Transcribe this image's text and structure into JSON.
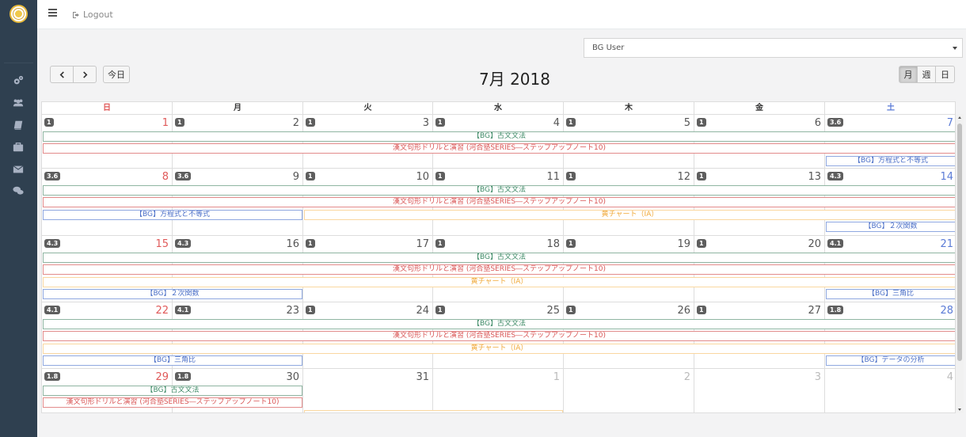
{
  "header": {
    "logout_label": "Logout"
  },
  "select": {
    "value": "BG User"
  },
  "toolbar": {
    "today_label": "今日",
    "title": "7月 2018",
    "views": [
      "月",
      "週",
      "日"
    ]
  },
  "dow": [
    "日",
    "月",
    "火",
    "水",
    "木",
    "金",
    "土"
  ],
  "colors": {
    "sidebar": "#2f4050",
    "sunday": "#e05a5a",
    "saturday": "#5b7bd6",
    "green_event": "#3d8a66",
    "red_event": "#d95555",
    "blue_event": "#4b6fc7",
    "orange_event": "#f0a93a"
  },
  "icons": [
    "gears-icon",
    "users-icon",
    "book-icon",
    "briefcase-icon",
    "envelope-icon",
    "chat-icon"
  ],
  "weeks": [
    {
      "days": [
        {
          "num": "1",
          "badge": "1",
          "type": "sun"
        },
        {
          "num": "2",
          "badge": "1"
        },
        {
          "num": "3",
          "badge": "1"
        },
        {
          "num": "4",
          "badge": "1"
        },
        {
          "num": "5",
          "badge": "1"
        },
        {
          "num": "6",
          "badge": "1"
        },
        {
          "num": "7",
          "badge": "3.6",
          "type": "sat"
        }
      ],
      "events": [
        {
          "title": "【BG】古文文法",
          "color": "green",
          "start": 0,
          "end": 6,
          "row": 0
        },
        {
          "title": "漢文句形ドリルと演習 (河合塾SERIES―ステップアップノート10)",
          "color": "red",
          "start": 0,
          "end": 6,
          "row": 1
        },
        {
          "title": "【BG】方程式と不等式",
          "color": "blue",
          "start": 6,
          "end": 6,
          "row": 2
        }
      ]
    },
    {
      "days": [
        {
          "num": "8",
          "badge": "3.6",
          "type": "sun"
        },
        {
          "num": "9",
          "badge": "3.6"
        },
        {
          "num": "10",
          "badge": "1"
        },
        {
          "num": "11",
          "badge": "1"
        },
        {
          "num": "12",
          "badge": "1"
        },
        {
          "num": "13",
          "badge": "1"
        },
        {
          "num": "14",
          "badge": "4.3",
          "type": "sat"
        }
      ],
      "events": [
        {
          "title": "【BG】古文文法",
          "color": "green",
          "start": 0,
          "end": 6,
          "row": 0
        },
        {
          "title": "漢文句形ドリルと演習 (河合塾SERIES―ステップアップノート10)",
          "color": "red",
          "start": 0,
          "end": 6,
          "row": 1
        },
        {
          "title": "【BG】方程式と不等式",
          "color": "blue",
          "start": 0,
          "end": 1,
          "row": 2
        },
        {
          "title": "黄チャート（ⅠA）",
          "color": "orange",
          "start": 2,
          "end": 6,
          "row": 2
        },
        {
          "title": "【BG】２次関数",
          "color": "blue",
          "start": 6,
          "end": 6,
          "row": 3
        }
      ]
    },
    {
      "days": [
        {
          "num": "15",
          "badge": "4.3",
          "type": "sun"
        },
        {
          "num": "16",
          "badge": "4.3"
        },
        {
          "num": "17",
          "badge": "1"
        },
        {
          "num": "18",
          "badge": "1"
        },
        {
          "num": "19",
          "badge": "1"
        },
        {
          "num": "20",
          "badge": "1"
        },
        {
          "num": "21",
          "badge": "4.1",
          "type": "sat"
        }
      ],
      "events": [
        {
          "title": "【BG】古文文法",
          "color": "green",
          "start": 0,
          "end": 6,
          "row": 0
        },
        {
          "title": "漢文句形ドリルと演習 (河合塾SERIES―ステップアップノート10)",
          "color": "red",
          "start": 0,
          "end": 6,
          "row": 1
        },
        {
          "title": "黄チャート（ⅠA）",
          "color": "orange",
          "start": 0,
          "end": 6,
          "row": 2
        },
        {
          "title": "【BG】２次関数",
          "color": "blue",
          "start": 0,
          "end": 1,
          "row": 3
        },
        {
          "title": "【BG】三角比",
          "color": "blue",
          "start": 6,
          "end": 6,
          "row": 3
        }
      ]
    },
    {
      "days": [
        {
          "num": "22",
          "badge": "4.1",
          "type": "sun"
        },
        {
          "num": "23",
          "badge": "4.1"
        },
        {
          "num": "24",
          "badge": "1"
        },
        {
          "num": "25",
          "badge": "1"
        },
        {
          "num": "26",
          "badge": "1"
        },
        {
          "num": "27",
          "badge": "1"
        },
        {
          "num": "28",
          "badge": "1.8",
          "type": "sat"
        }
      ],
      "events": [
        {
          "title": "【BG】古文文法",
          "color": "green",
          "start": 0,
          "end": 6,
          "row": 0
        },
        {
          "title": "漢文句形ドリルと演習 (河合塾SERIES―ステップアップノート10)",
          "color": "red",
          "start": 0,
          "end": 6,
          "row": 1
        },
        {
          "title": "黄チャート（ⅠA）",
          "color": "orange",
          "start": 0,
          "end": 6,
          "row": 2
        },
        {
          "title": "【BG】三角比",
          "color": "blue",
          "start": 0,
          "end": 1,
          "row": 3
        },
        {
          "title": "【BG】データの分析",
          "color": "blue",
          "start": 6,
          "end": 6,
          "row": 3
        }
      ]
    },
    {
      "days": [
        {
          "num": "29",
          "badge": "1.8",
          "type": "sun"
        },
        {
          "num": "30",
          "badge": "1.8"
        },
        {
          "num": "31"
        },
        {
          "num": "1",
          "type": "other"
        },
        {
          "num": "2",
          "type": "other"
        },
        {
          "num": "3",
          "type": "other"
        },
        {
          "num": "4",
          "type": "other"
        }
      ],
      "events": [
        {
          "title": "【BG】古文文法",
          "color": "green",
          "start": 0,
          "end": 1,
          "row": 0
        },
        {
          "title": "漢文句形ドリルと演習 (河合塾SERIES―ステップアップノート10)",
          "color": "red",
          "start": 0,
          "end": 1,
          "row": 1
        },
        {
          "title": "",
          "color": "orange",
          "start": 2,
          "end": 3,
          "row": 2
        }
      ]
    }
  ]
}
